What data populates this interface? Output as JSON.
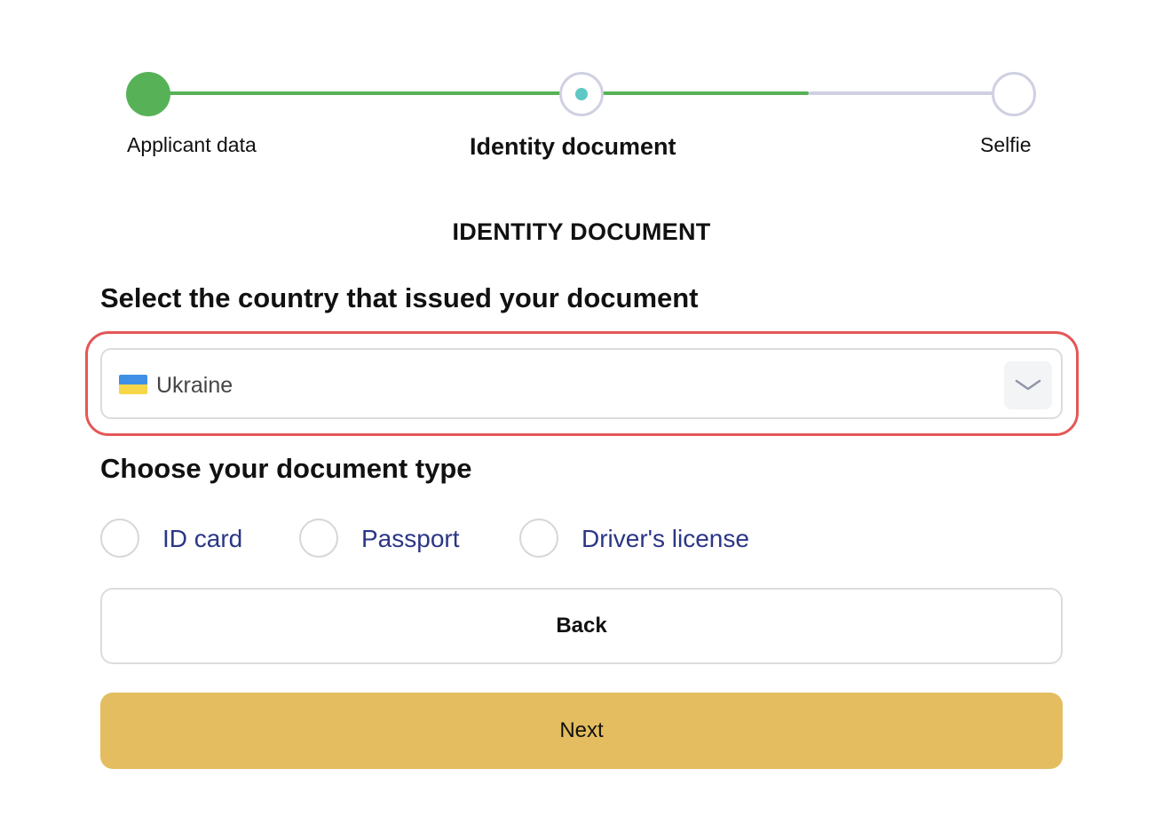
{
  "stepper": {
    "steps": [
      {
        "label": "Applicant data",
        "state": "completed"
      },
      {
        "label": "Identity document",
        "state": "current"
      },
      {
        "label": "Selfie",
        "state": "upcoming"
      }
    ]
  },
  "section_title": "IDENTITY DOCUMENT",
  "country": {
    "question": "Select the country that issued your document",
    "selected_value": "Ukraine",
    "flag_icon": "ukraine-flag-icon",
    "toggle_icon": "chevron-down-icon"
  },
  "document_type": {
    "question": "Choose your document type",
    "options": [
      {
        "label": "ID card",
        "checked": false
      },
      {
        "label": "Passport",
        "checked": false
      },
      {
        "label": "Driver's license",
        "checked": false
      }
    ]
  },
  "buttons": {
    "back_label": "Back",
    "next_label": "Next"
  },
  "colors": {
    "progress_complete": "#57b257",
    "progress_pending": "#cfd0e2",
    "current_step_dot": "#5ec8c4",
    "highlight_outline": "#e45757",
    "next_button": "#e3bd5f",
    "radio_label_text": "#2b3686"
  }
}
